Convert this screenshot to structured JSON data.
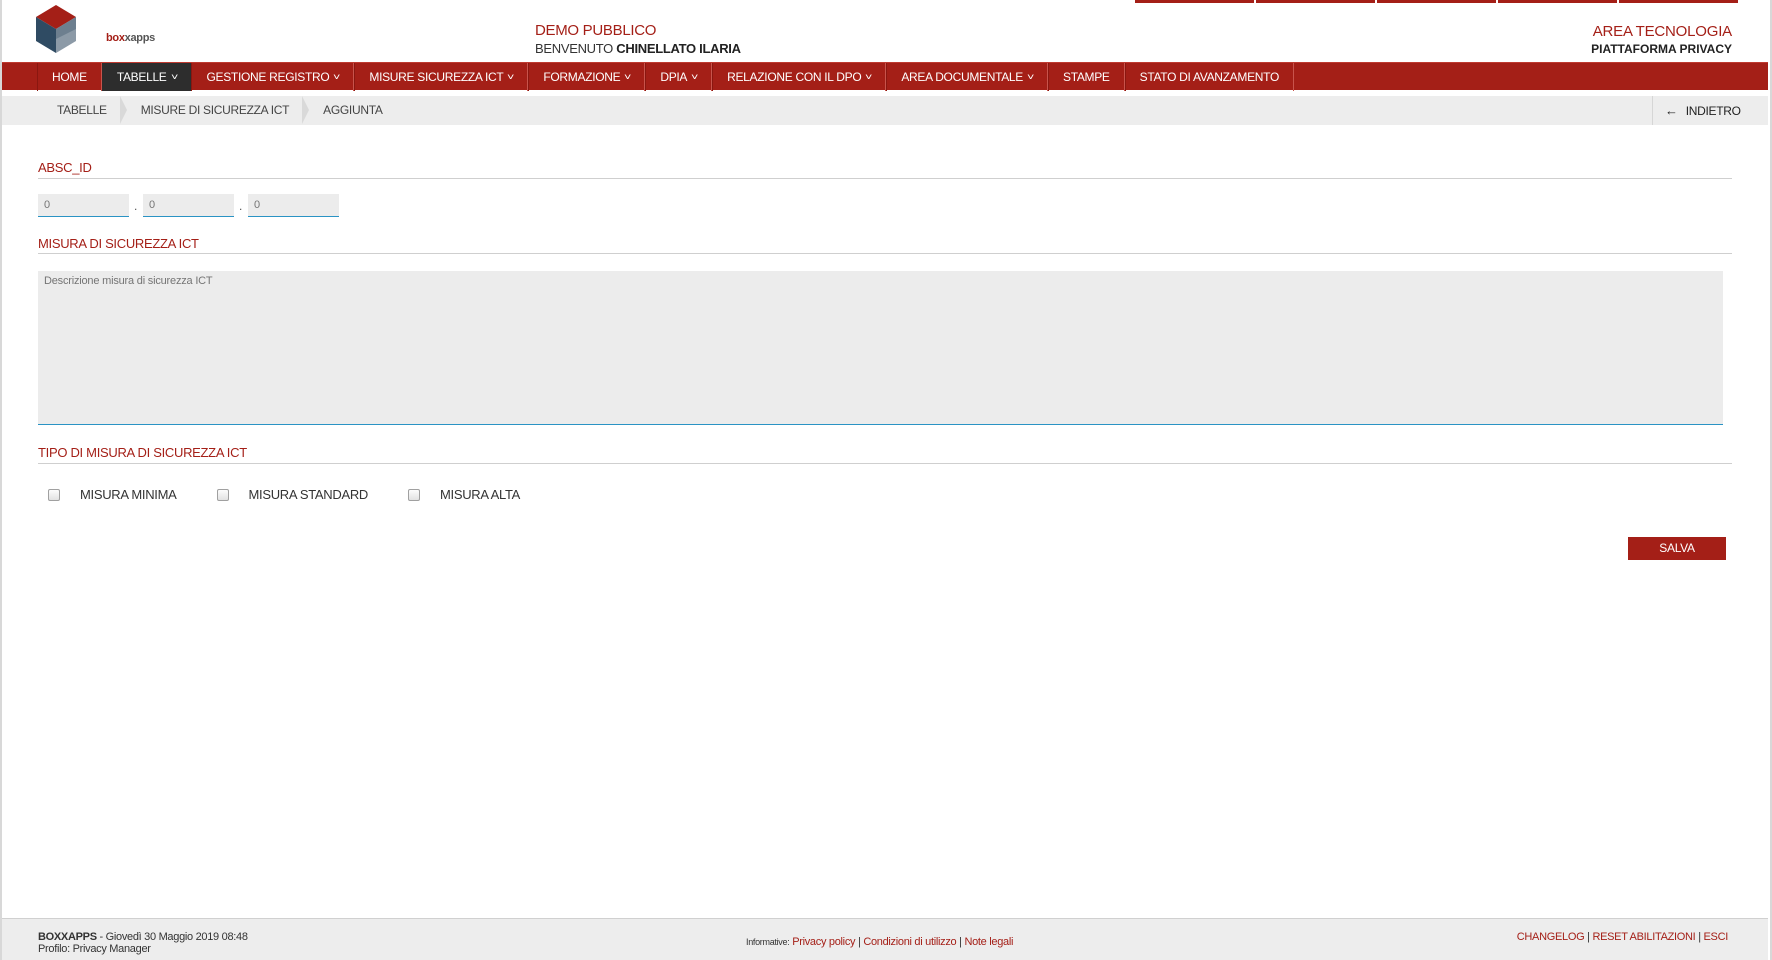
{
  "header": {
    "logo_text_a": "box",
    "logo_text_b": "xapps",
    "company": "DEMO PUBBLICO",
    "welcome_prefix": "BENVENUTO",
    "user": "CHINELLATO ILARIA",
    "area": "AREA TECNOLOGIA",
    "platform": "PIATTAFORMA PRIVACY"
  },
  "nav": {
    "items": [
      {
        "label": "HOME",
        "dropdown": false
      },
      {
        "label": "TABELLE",
        "dropdown": true
      },
      {
        "label": "GESTIONE REGISTRO",
        "dropdown": true
      },
      {
        "label": "MISURE SICUREZZA ICT",
        "dropdown": true
      },
      {
        "label": "FORMAZIONE",
        "dropdown": true
      },
      {
        "label": "DPIA",
        "dropdown": true
      },
      {
        "label": "RELAZIONE CON IL DPO",
        "dropdown": true
      },
      {
        "label": "AREA DOCUMENTALE",
        "dropdown": true
      },
      {
        "label": "STAMPE",
        "dropdown": false
      },
      {
        "label": "STATO DI AVANZAMENTO",
        "dropdown": false
      }
    ],
    "active_index": 1
  },
  "breadcrumb": {
    "items": [
      "TABELLE",
      "MISURE DI SICUREZZA ICT",
      "AGGIUNTA"
    ],
    "back_label": "INDIETRO"
  },
  "form": {
    "id_label": "ABSC_ID",
    "id_placeholders": [
      "0",
      "0",
      "0"
    ],
    "id_separator": ".",
    "measure_label": "MISURA DI SICUREZZA ICT",
    "measure_placeholder": "Descrizione misura di sicurezza ICT",
    "type_label": "TIPO DI MISURA DI SICUREZZA ICT",
    "types": [
      "MISURA MINIMA",
      "MISURA STANDARD",
      "MISURA ALTA"
    ],
    "save_label": "SALVA"
  },
  "footer": {
    "brand": "BOXXAPPS",
    "date": " - Giovedì 30 Maggio 2019 08:48",
    "profile": "Profilo: Privacy Manager",
    "info_label": "Informative:",
    "privacy": "Privacy policy",
    "conditions": "Condizioni di utilizzo",
    "legal": "Note legali",
    "changelog": "CHANGELOG",
    "reset": "RESET ABILITAZIONI",
    "logout": "ESCI"
  },
  "colors": {
    "accent": "#a41f17",
    "nav_active": "#2d2d2d",
    "input_bg": "#ececec",
    "input_focus_line": "#2a93c4"
  }
}
